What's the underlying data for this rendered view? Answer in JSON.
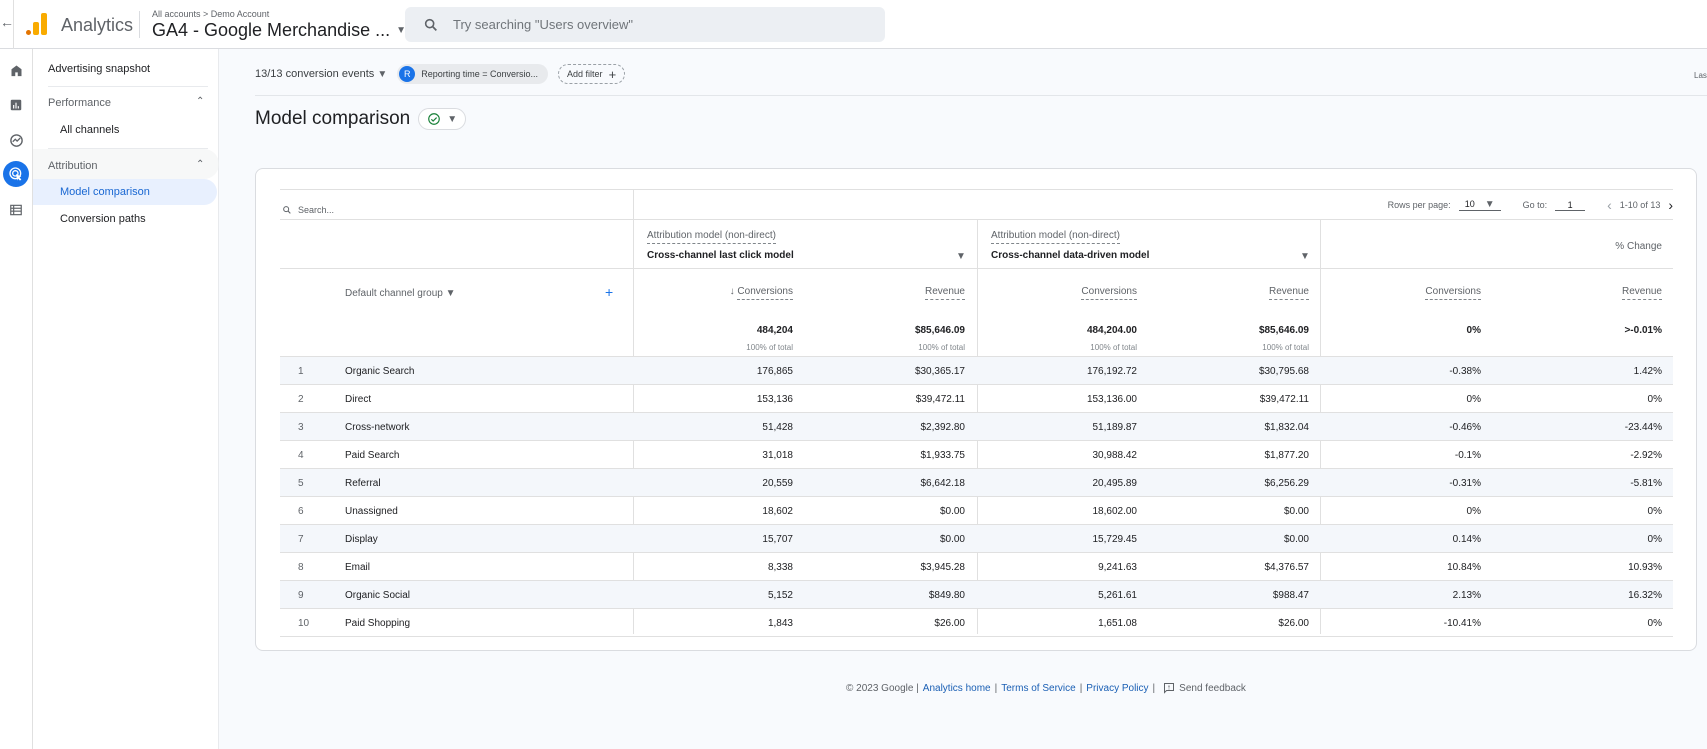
{
  "topbar": {
    "app_name": "Analytics",
    "breadcrumb": "All accounts > Demo Account",
    "property": "GA4 - Google Merchandise ...",
    "search_placeholder": "Try searching \"Users overview\""
  },
  "rail": {
    "icons": [
      "home-icon",
      "reports-icon",
      "explore-icon",
      "advertising-icon",
      "configure-icon"
    ],
    "active": "advertising-icon"
  },
  "sidenav": {
    "advertising_snapshot": "Advertising snapshot",
    "performance": "Performance",
    "all_channels": "All channels",
    "attribution": "Attribution",
    "model_comparison": "Model comparison",
    "conversion_paths": "Conversion paths"
  },
  "filters": {
    "conversion_events": "13/13 conversion events",
    "chip_letter": "R",
    "chip_label": "Reporting time = Conversio...",
    "add_filter": "Add filter",
    "date_truncated": "Las"
  },
  "page": {
    "title": "Model comparison"
  },
  "table": {
    "search_placeholder": "Search...",
    "rows_per_page_label": "Rows per page:",
    "rows_per_page": "10",
    "goto_label": "Go to:",
    "goto_value": "1",
    "range": "1-10 of 13",
    "dimension": "Default channel group",
    "model1": {
      "label": "Attribution model (non-direct)",
      "name": "Cross-channel last click model"
    },
    "model2": {
      "label": "Attribution model (non-direct)",
      "name": "Cross-channel data-driven model"
    },
    "change_label": "% Change",
    "metric_conv": "Conversions",
    "metric_rev": "Revenue",
    "totals": {
      "m1_conv": "484,204",
      "m1_rev": "$85,646.09",
      "m2_conv": "484,204.00",
      "m2_rev": "$85,646.09",
      "chg_conv": "0%",
      "chg_rev": ">-0.01%",
      "of_total": "100% of total"
    },
    "rows": [
      {
        "n": "1",
        "channel": "Organic Search",
        "m1_conv": "176,865",
        "m1_rev": "$30,365.17",
        "m2_conv": "176,192.72",
        "m2_rev": "$30,795.68",
        "chg_conv": "-0.38%",
        "chg_rev": "1.42%"
      },
      {
        "n": "2",
        "channel": "Direct",
        "m1_conv": "153,136",
        "m1_rev": "$39,472.11",
        "m2_conv": "153,136.00",
        "m2_rev": "$39,472.11",
        "chg_conv": "0%",
        "chg_rev": "0%"
      },
      {
        "n": "3",
        "channel": "Cross-network",
        "m1_conv": "51,428",
        "m1_rev": "$2,392.80",
        "m2_conv": "51,189.87",
        "m2_rev": "$1,832.04",
        "chg_conv": "-0.46%",
        "chg_rev": "-23.44%"
      },
      {
        "n": "4",
        "channel": "Paid Search",
        "m1_conv": "31,018",
        "m1_rev": "$1,933.75",
        "m2_conv": "30,988.42",
        "m2_rev": "$1,877.20",
        "chg_conv": "-0.1%",
        "chg_rev": "-2.92%"
      },
      {
        "n": "5",
        "channel": "Referral",
        "m1_conv": "20,559",
        "m1_rev": "$6,642.18",
        "m2_conv": "20,495.89",
        "m2_rev": "$6,256.29",
        "chg_conv": "-0.31%",
        "chg_rev": "-5.81%"
      },
      {
        "n": "6",
        "channel": "Unassigned",
        "m1_conv": "18,602",
        "m1_rev": "$0.00",
        "m2_conv": "18,602.00",
        "m2_rev": "$0.00",
        "chg_conv": "0%",
        "chg_rev": "0%"
      },
      {
        "n": "7",
        "channel": "Display",
        "m1_conv": "15,707",
        "m1_rev": "$0.00",
        "m2_conv": "15,729.45",
        "m2_rev": "$0.00",
        "chg_conv": "0.14%",
        "chg_rev": "0%"
      },
      {
        "n": "8",
        "channel": "Email",
        "m1_conv": "8,338",
        "m1_rev": "$3,945.28",
        "m2_conv": "9,241.63",
        "m2_rev": "$4,376.57",
        "chg_conv": "10.84%",
        "chg_rev": "10.93%"
      },
      {
        "n": "9",
        "channel": "Organic Social",
        "m1_conv": "5,152",
        "m1_rev": "$849.80",
        "m2_conv": "5,261.61",
        "m2_rev": "$988.47",
        "chg_conv": "2.13%",
        "chg_rev": "16.32%"
      },
      {
        "n": "10",
        "channel": "Paid Shopping",
        "m1_conv": "1,843",
        "m1_rev": "$26.00",
        "m2_conv": "1,651.08",
        "m2_rev": "$26.00",
        "chg_conv": "-10.41%",
        "chg_rev": "0%"
      }
    ]
  },
  "footer": {
    "copyright": "© 2023 Google |",
    "analytics_home": "Analytics home",
    "terms": "Terms of Service",
    "privacy": "Privacy Policy",
    "feedback": "Send feedback",
    "sep": "|"
  },
  "colors": {
    "accent": "#1a73e8",
    "active_nav_bg": "#e8f0fe",
    "logo_orange": "#f9ab00",
    "logo_dark_orange": "#e37400"
  }
}
